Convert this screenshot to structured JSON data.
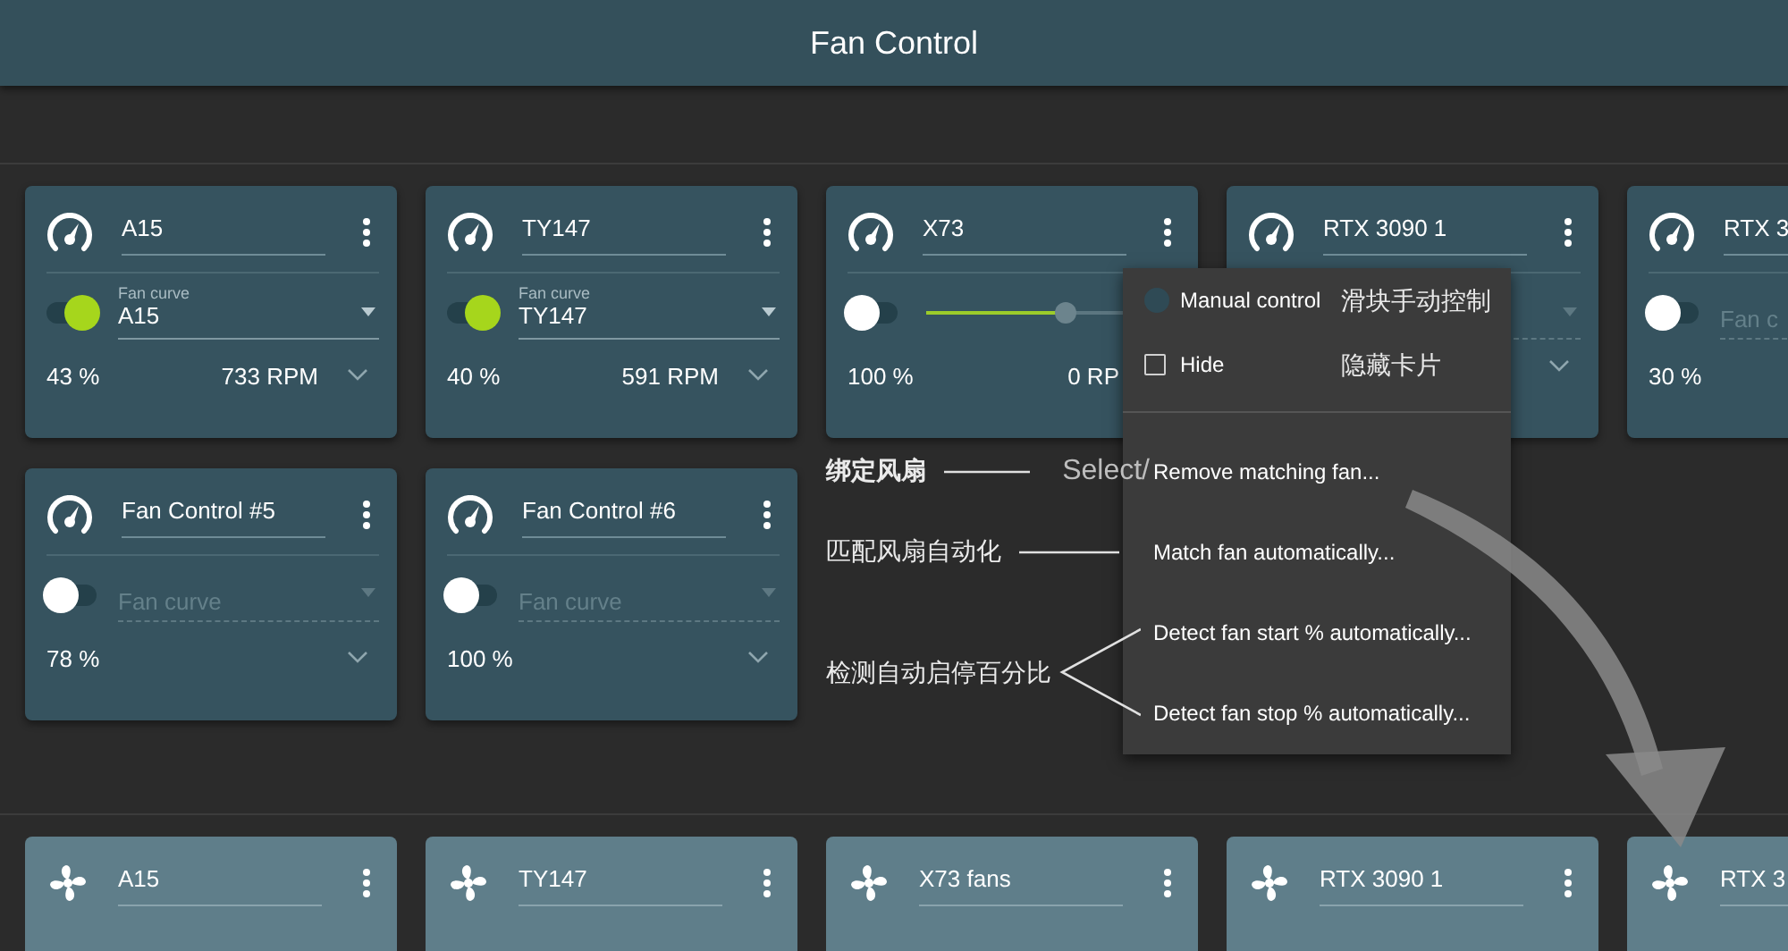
{
  "window": {
    "title": "Fan Control"
  },
  "control_rows": [
    [
      {
        "name": "A15",
        "kind": "curve",
        "toggle_on": true,
        "curve_label": "Fan curve",
        "curve": "A15",
        "percent": "43 %",
        "rpm": "733 RPM"
      },
      {
        "name": "TY147",
        "kind": "curve",
        "toggle_on": true,
        "curve_label": "Fan curve",
        "curve": "TY147",
        "percent": "40 %",
        "rpm": "591 RPM"
      },
      {
        "name": "X73",
        "kind": "slider",
        "toggle_on": false,
        "level": 0.55,
        "percent": "100 %",
        "rpm": "0 RP"
      },
      {
        "name": "RTX 3090 1",
        "kind": "curve"
      },
      {
        "name": "RTX 3",
        "kind": "curve",
        "toggle_on": false,
        "placeholder": "Fan c",
        "percent": "30 %"
      }
    ],
    [
      {
        "name": "Fan Control #5",
        "kind": "curve",
        "toggle_on": false,
        "placeholder": "Fan curve",
        "percent": "78 %"
      },
      {
        "name": "Fan Control #6",
        "kind": "curve",
        "toggle_on": false,
        "placeholder": "Fan curve",
        "percent": "100 %"
      }
    ]
  ],
  "menu": {
    "items": [
      {
        "kind": "radio",
        "label": "Manual control",
        "checked": false,
        "note": "滑块手动控制"
      },
      {
        "kind": "checkbox",
        "label": "Hide",
        "checked": false,
        "note": "隐藏卡片"
      },
      {
        "kind": "action",
        "label": "Remove matching fan..."
      },
      {
        "kind": "action",
        "label": "Match fan automatically..."
      },
      {
        "kind": "action",
        "label": "Detect fan start % automatically..."
      },
      {
        "kind": "action",
        "label": "Detect fan stop % automatically..."
      }
    ]
  },
  "annotations": [
    {
      "kind": "line",
      "text": "绑定风扇",
      "bold": true,
      "suffix": "Select/"
    },
    {
      "kind": "line",
      "text": "匹配风扇自动化",
      "bold": false
    },
    {
      "kind": "bracket",
      "text": "检测自动启停百分比",
      "bold": false
    }
  ],
  "speeds": [
    {
      "name": "A15"
    },
    {
      "name": "TY147"
    },
    {
      "name": "X73 fans"
    },
    {
      "name": "RTX 3090 1"
    },
    {
      "name": "RTX 3"
    }
  ]
}
